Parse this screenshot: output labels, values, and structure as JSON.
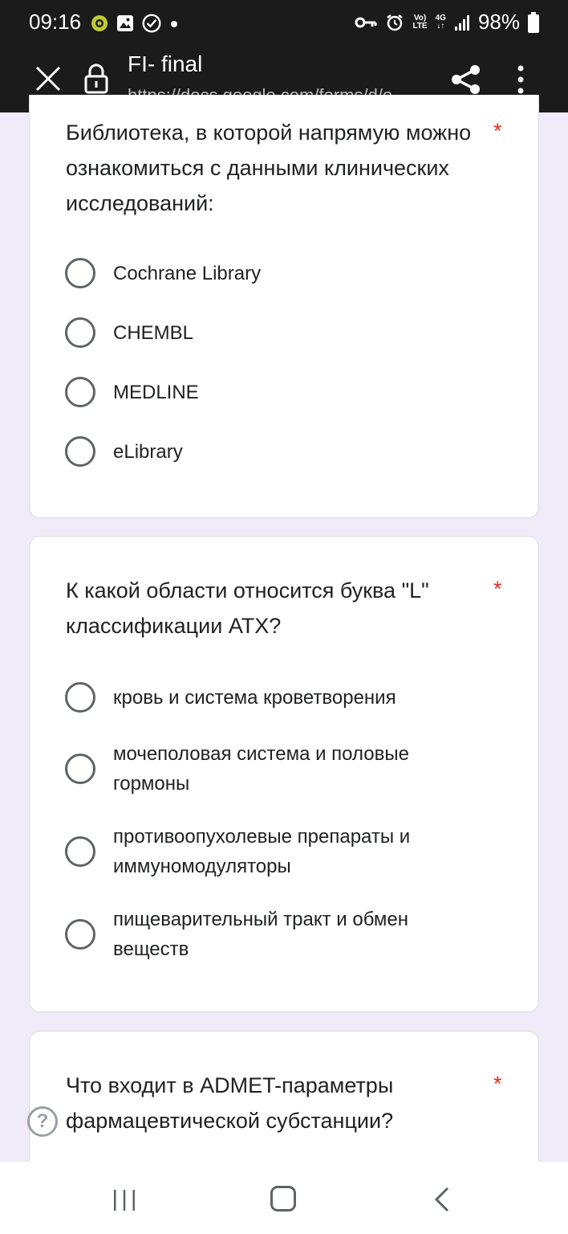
{
  "status_bar": {
    "time": "09:16",
    "battery": "98%",
    "network_top": "Vo)",
    "network_bottom": "LTE",
    "net_4g": "4G"
  },
  "app_bar": {
    "title": "FI- final",
    "url": "https://docs.google.com/forms/d/e"
  },
  "questions": [
    {
      "title": "Библиотека, в которой напрямую можно ознакомиться с данными клинических исследований:",
      "required": "*",
      "options": [
        "Cochrane Library",
        "CHEMBL",
        "MEDLINE",
        "eLibrary"
      ]
    },
    {
      "title": "К какой области относится буква \"L\" классификации АТХ?",
      "required": "*",
      "options": [
        "кровь и система кроветворения",
        "мочеполовая система и половые гормоны",
        "противоопухолевые препараты и иммуномодуляторы",
        "пищеварительный тракт и обмен веществ"
      ]
    },
    {
      "title": "Что входит в ADMET-параметры фармацевтической субстанции?",
      "required": "*",
      "options": []
    }
  ],
  "help": {
    "label": "?"
  },
  "colors": {
    "bar_bg": "#1b1b1b",
    "page_bg": "#f0ebf8",
    "required": "#d93025",
    "radio": "#5f6368"
  }
}
